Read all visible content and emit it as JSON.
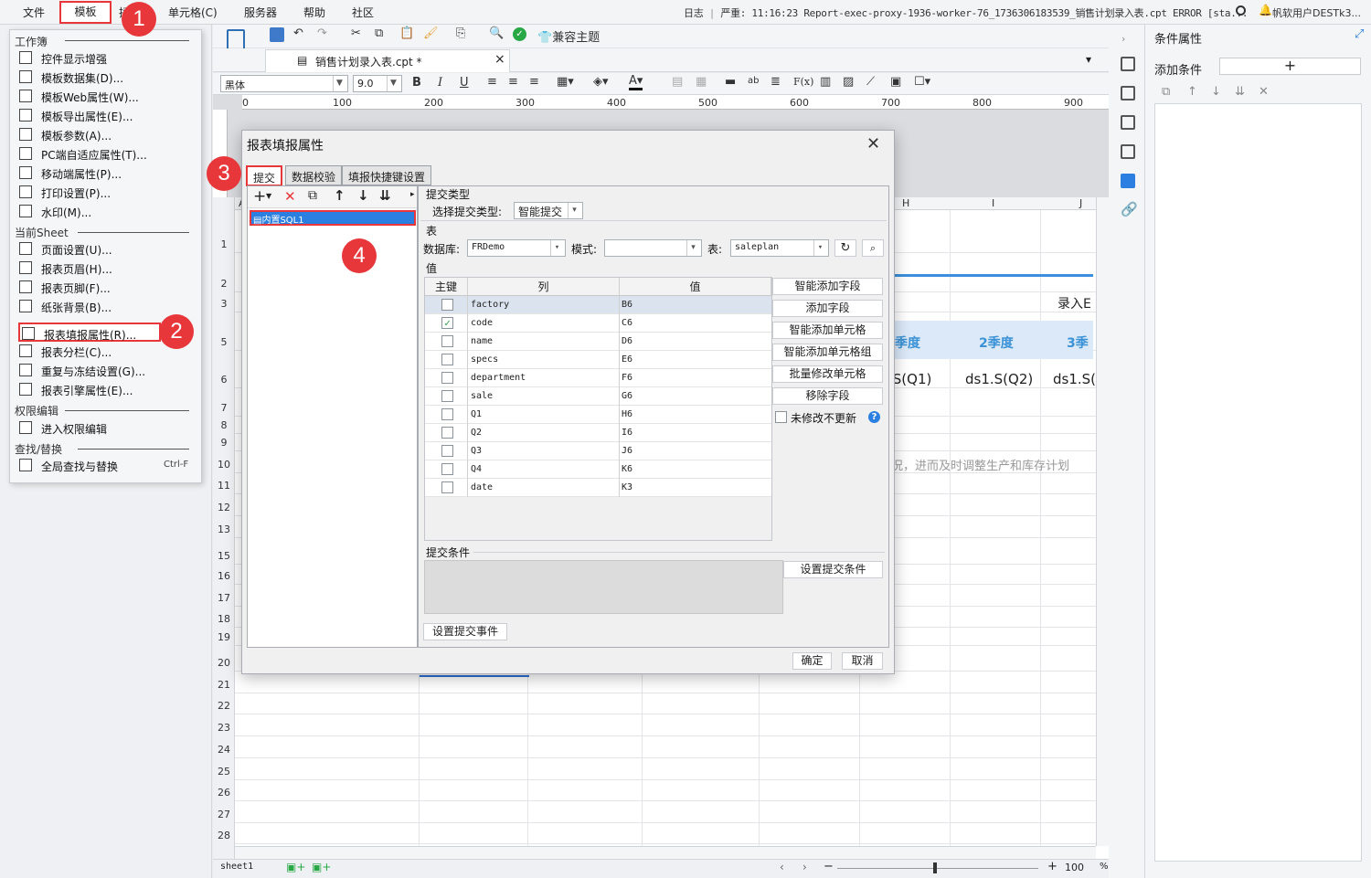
{
  "menubar": {
    "items": [
      "文件",
      "模板",
      "单元格(C)",
      "服务器",
      "帮助",
      "社区"
    ],
    "log_label": "日志",
    "log_message": "严重: 11:16:23 Report-exec-proxy-1936-worker-76_1736306183539_销售计划录入表.cpt ERROR [sta...",
    "user": "帆软用户DESTk3..."
  },
  "badges": [
    "1",
    "2",
    "3",
    "4"
  ],
  "dropdown": {
    "sections": [
      "工作簿",
      "当前Sheet",
      "权限编辑",
      "查找/替换"
    ],
    "workbook_items": [
      {
        "label": "控件显示增强",
        "shortcut": ""
      },
      {
        "label": "模板数据集(D)...",
        "shortcut": ""
      },
      {
        "label": "模板Web属性(W)...",
        "shortcut": ""
      },
      {
        "label": "模板导出属性(E)...",
        "shortcut": ""
      },
      {
        "label": "模板参数(A)...",
        "shortcut": ""
      },
      {
        "label": "PC端自适应属性(T)...",
        "shortcut": ""
      },
      {
        "label": "移动端属性(P)...",
        "shortcut": ""
      },
      {
        "label": "打印设置(P)...",
        "shortcut": ""
      },
      {
        "label": "水印(M)...",
        "shortcut": ""
      }
    ],
    "sheet_items": [
      {
        "label": "页面设置(U)...",
        "shortcut": ""
      },
      {
        "label": "报表页眉(H)...",
        "shortcut": ""
      },
      {
        "label": "报表页脚(F)...",
        "shortcut": ""
      },
      {
        "label": "纸张背景(B)...",
        "shortcut": ""
      },
      {
        "label": "报表填报属性(R)...",
        "shortcut": ""
      },
      {
        "label": "报表分栏(C)...",
        "shortcut": ""
      },
      {
        "label": "重复与冻结设置(G)...",
        "shortcut": ""
      },
      {
        "label": "报表引擎属性(E)...",
        "shortcut": ""
      }
    ],
    "perm_items": [
      {
        "label": "进入权限编辑",
        "shortcut": ""
      }
    ],
    "find_items": [
      {
        "label": "全局查找与替换",
        "shortcut": "Ctrl-F"
      }
    ]
  },
  "toolbar": {
    "compat_theme": "兼容主题",
    "doc_tab": "销售计划录入表.cpt *",
    "font_name": "黑体",
    "font_size": "9.0"
  },
  "ruler": {
    "marks": [
      "0",
      "100",
      "200",
      "300",
      "400",
      "500",
      "600",
      "700",
      "800",
      "900"
    ]
  },
  "sheet": {
    "row_numbers": [
      "1",
      "2",
      "3",
      "5",
      "6",
      "7",
      "8",
      "9",
      "10",
      "11",
      "12",
      "13",
      "15",
      "16",
      "17",
      "18",
      "19",
      "20",
      "21",
      "22",
      "23",
      "24",
      "25",
      "26",
      "27",
      "28"
    ],
    "col_headers": [
      "A",
      "H",
      "I",
      "J"
    ],
    "entry_label": "录入E",
    "quarters": [
      "季度",
      "2季度",
      "3季"
    ],
    "formulas": [
      ".S(Q1)",
      "ds1.S(Q2)",
      "ds1.S("
    ],
    "note": "况，进而及时调整生产和库存计划",
    "sheet_tab": "sheet1",
    "zoom": "100",
    "zoom_unit": "%"
  },
  "rightpanel": {
    "title": "条件属性",
    "add_condition": "添加条件"
  },
  "dialog": {
    "title": "报表填报属性",
    "tabs": [
      "提交",
      "数据校验",
      "填报快捷键设置"
    ],
    "sql_item": "内置SQL1",
    "submit_type_heading": "提交类型",
    "submit_type_label": "选择提交类型:",
    "submit_type_value": "智能提交",
    "table_heading": "表",
    "db_label": "数据库:",
    "db_value": "FRDemo",
    "schema_label": "模式:",
    "schema_value": "",
    "table_label": "表:",
    "table_value": "saleplan",
    "value_heading": "值",
    "grid_headers": [
      "主键",
      "列",
      "值"
    ],
    "rows": [
      {
        "col": "factory",
        "val": "B6",
        "key": false
      },
      {
        "col": "code",
        "val": "C6",
        "key": true
      },
      {
        "col": "name",
        "val": "D6",
        "key": false
      },
      {
        "col": "specs",
        "val": "E6",
        "key": false
      },
      {
        "col": "department",
        "val": "F6",
        "key": false
      },
      {
        "col": "sale",
        "val": "G6",
        "key": false
      },
      {
        "col": "Q1",
        "val": "H6",
        "key": false
      },
      {
        "col": "Q2",
        "val": "I6",
        "key": false
      },
      {
        "col": "Q3",
        "val": "J6",
        "key": false
      },
      {
        "col": "Q4",
        "val": "K6",
        "key": false
      },
      {
        "col": "date",
        "val": "K3",
        "key": false
      }
    ],
    "side_buttons": [
      "智能添加字段",
      "添加字段",
      "智能添加单元格",
      "智能添加单元格组",
      "批量修改单元格",
      "移除字段"
    ],
    "no_update_label": "未修改不更新",
    "cond_heading": "提交条件",
    "set_cond_button": "设置提交条件",
    "set_event_button": "设置提交事件",
    "ok": "确定",
    "cancel": "取消"
  }
}
